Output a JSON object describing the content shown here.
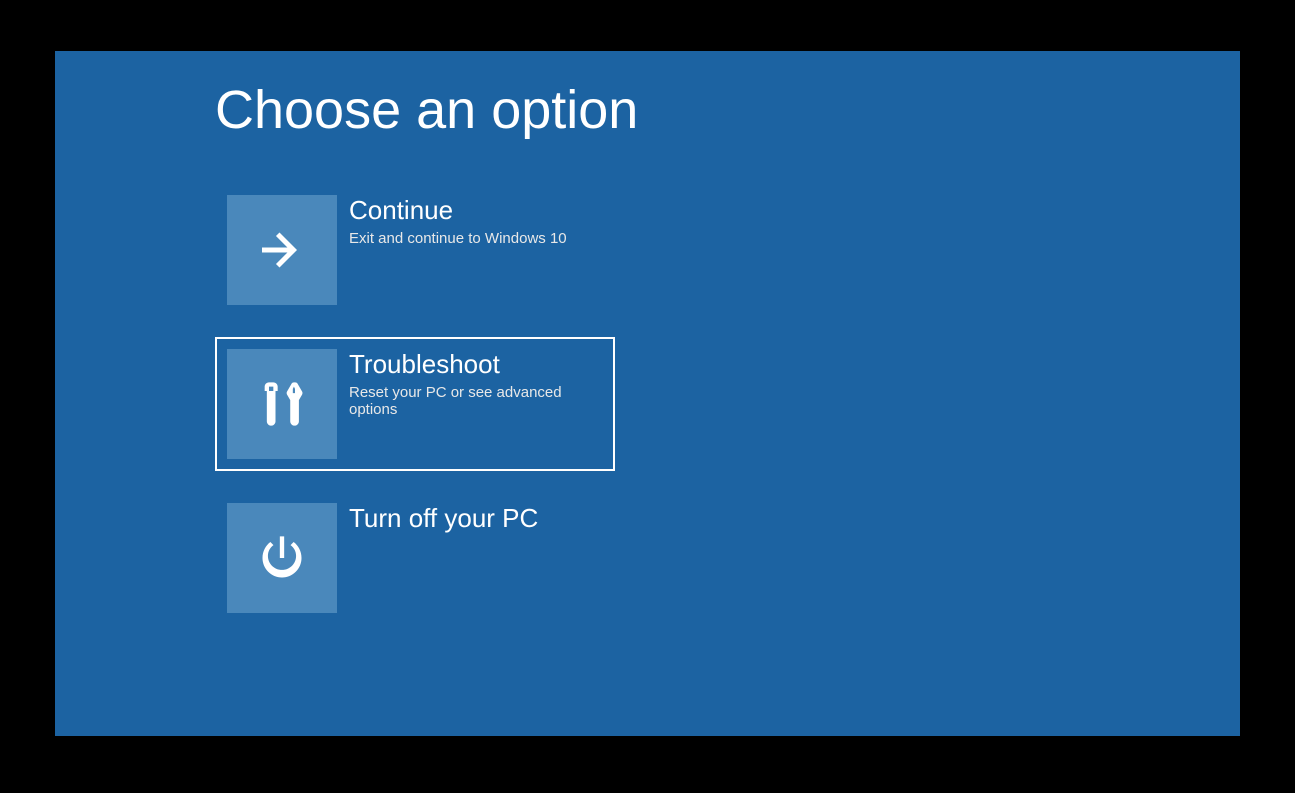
{
  "screen": {
    "title": "Choose an option",
    "options": [
      {
        "title": "Continue",
        "description": "Exit and continue to Windows 10",
        "icon": "arrow-right"
      },
      {
        "title": "Troubleshoot",
        "description": "Reset your PC or see advanced options",
        "icon": "tools"
      },
      {
        "title": "Turn off your PC",
        "description": "",
        "icon": "power"
      }
    ]
  },
  "colors": {
    "background": "#1c63a2",
    "tile": "#4a88bb",
    "outer": "#000000"
  }
}
